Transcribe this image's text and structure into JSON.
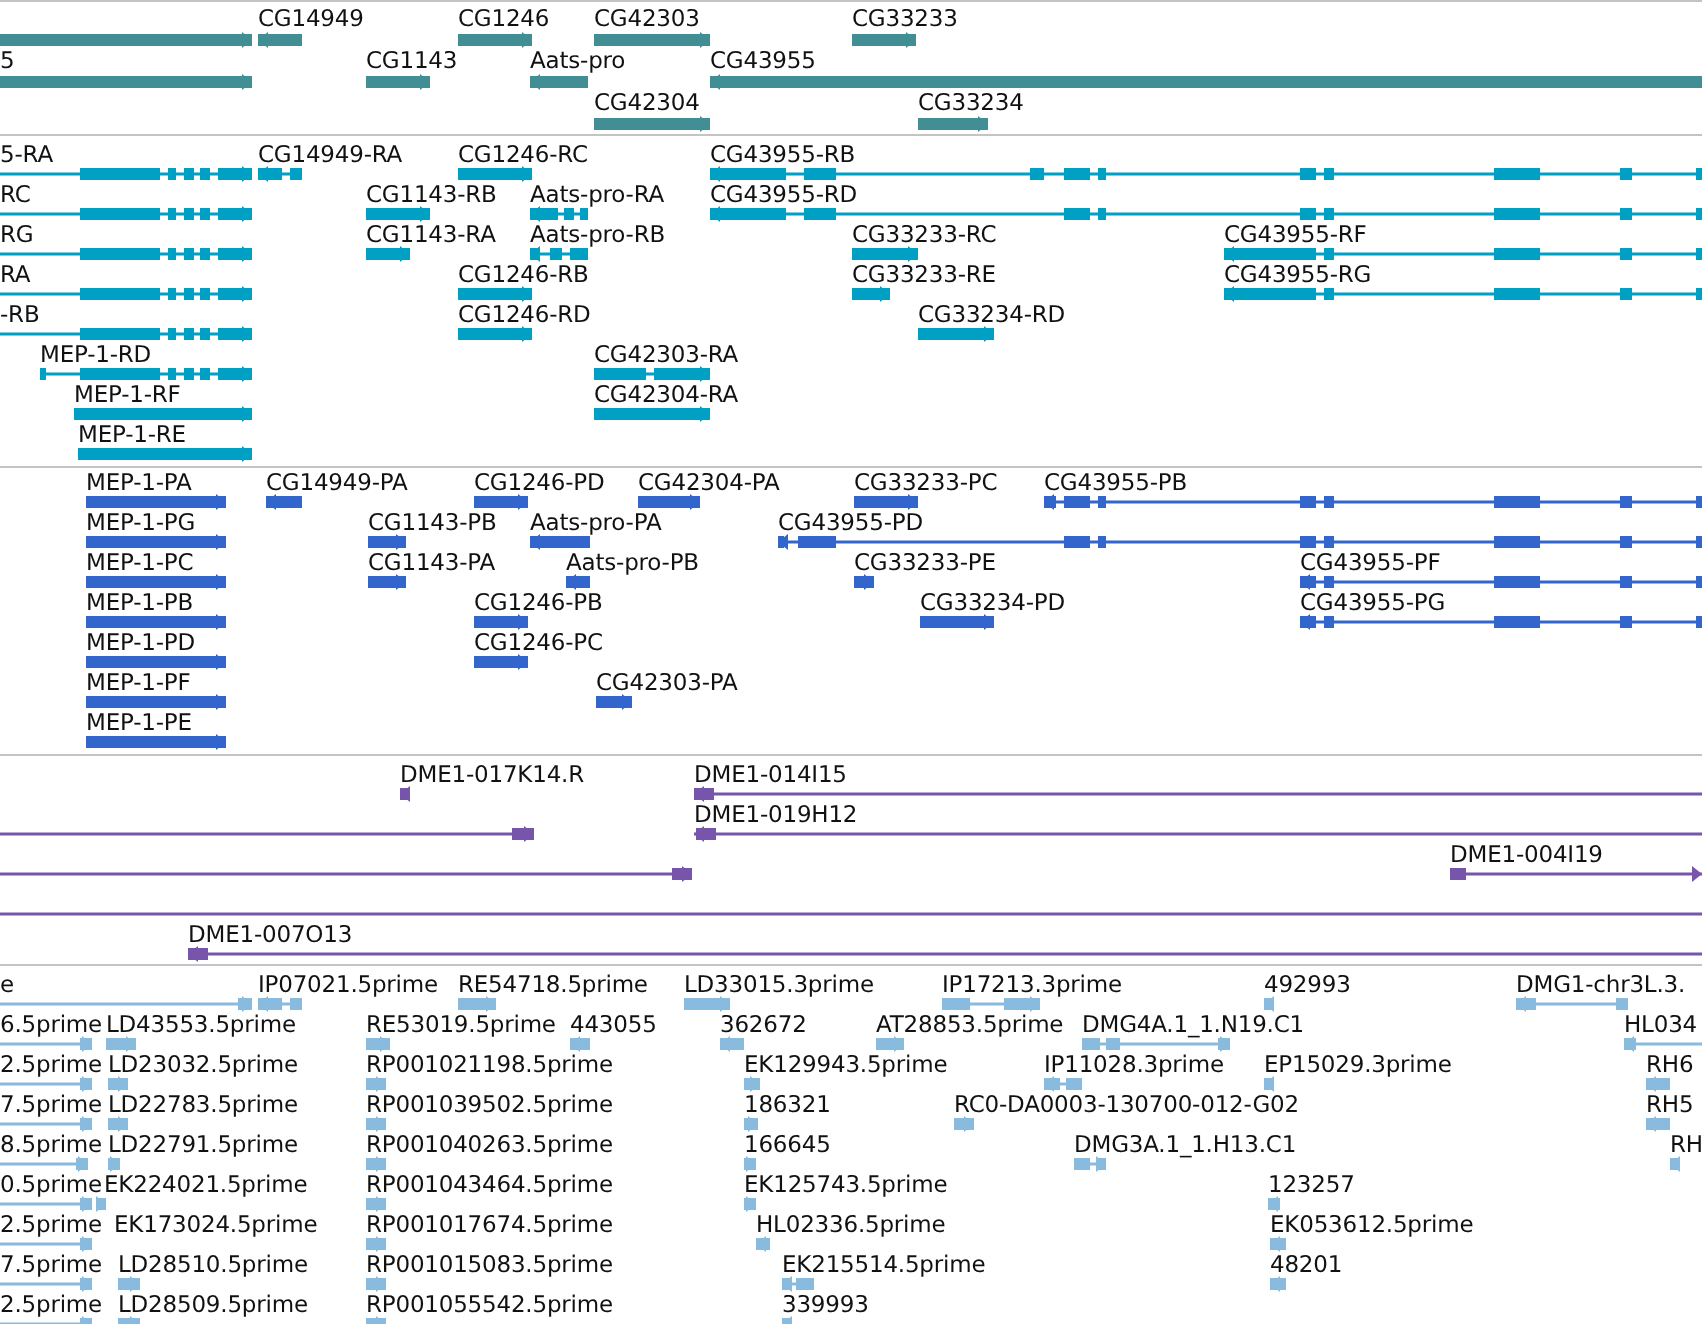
{
  "tracks": [
    {
      "kind": "gene",
      "features": [
        {
          "reverse": false
        },
        {
          "label": "CG14949",
          "reverse": true
        },
        {
          "label": "CG1246",
          "reverse": false
        },
        {
          "label": "CG42303",
          "reverse": false
        },
        {
          "label": "CG33233",
          "reverse": false
        },
        {
          "label": "5",
          "reverse": false
        },
        {
          "label": "CG1143",
          "reverse": false
        },
        {
          "label": "Aats-pro",
          "reverse": true
        },
        {
          "label": "CG43955",
          "reverse": true
        },
        {
          "label": "CG42304",
          "reverse": false
        },
        {
          "label": "CG33234",
          "reverse": false
        }
      ]
    },
    {
      "kind": "transcript",
      "features": [
        {
          "label": "5-RA",
          "reverse": false
        },
        {
          "label": "CG14949-RA",
          "reverse": true
        },
        {
          "label": "CG1246-RC",
          "reverse": false
        },
        {
          "label": "CG43955-RB",
          "reverse": true
        },
        {
          "label": "RC",
          "reverse": false
        },
        {
          "label": "CG1143-RB",
          "reverse": false
        },
        {
          "label": "Aats-pro-RA",
          "reverse": true
        },
        {
          "label": "CG43955-RD",
          "reverse": true
        },
        {
          "label": "RG",
          "reverse": false
        },
        {
          "label": "CG1143-RA",
          "reverse": false
        },
        {
          "label": "Aats-pro-RB",
          "reverse": true
        },
        {
          "label": "CG33233-RC",
          "reverse": false
        },
        {
          "label": "CG43955-RF",
          "reverse": true
        },
        {
          "label": "RA",
          "reverse": false
        },
        {
          "label": "CG1246-RB",
          "reverse": false
        },
        {
          "label": "CG33233-RE",
          "reverse": false
        },
        {
          "label": "CG43955-RG",
          "reverse": true
        },
        {
          "label": "-RB",
          "reverse": false
        },
        {
          "label": "CG1246-RD",
          "reverse": false
        },
        {
          "label": "CG33234-RD",
          "reverse": false
        },
        {
          "label": "MEP-1-RD",
          "reverse": false
        },
        {
          "label": "CG42303-RA",
          "reverse": false
        },
        {
          "label": "MEP-1-RF",
          "reverse": false
        },
        {
          "label": "CG42304-RA",
          "reverse": false
        },
        {
          "label": "MEP-1-RE",
          "reverse": false
        }
      ]
    },
    {
      "kind": "protein",
      "features": [
        {
          "label": "MEP-1-PA",
          "reverse": false
        },
        {
          "label": "CG14949-PA",
          "reverse": true
        },
        {
          "label": "CG1246-PD",
          "reverse": false
        },
        {
          "label": "CG42304-PA",
          "reverse": false
        },
        {
          "label": "CG33233-PC",
          "reverse": false
        },
        {
          "label": "CG43955-PB",
          "reverse": true
        },
        {
          "label": "MEP-1-PG",
          "reverse": false
        },
        {
          "label": "CG1143-PB",
          "reverse": false
        },
        {
          "label": "Aats-pro-PA",
          "reverse": true
        },
        {
          "label": "CG43955-PD",
          "reverse": true
        },
        {
          "label": "MEP-1-PC",
          "reverse": false
        },
        {
          "label": "CG1143-PA",
          "reverse": false
        },
        {
          "label": "Aats-pro-PB",
          "reverse": true
        },
        {
          "label": "CG33233-PE",
          "reverse": false
        },
        {
          "label": "CG43955-PF",
          "reverse": true
        },
        {
          "label": "MEP-1-PB",
          "reverse": false
        },
        {
          "label": "CG1246-PB",
          "reverse": false
        },
        {
          "label": "CG33234-PD",
          "reverse": false
        },
        {
          "label": "CG43955-PG",
          "reverse": true
        },
        {
          "label": "MEP-1-PD",
          "reverse": false
        },
        {
          "label": "CG1246-PC",
          "reverse": false
        },
        {
          "label": "MEP-1-PF",
          "reverse": false
        },
        {
          "label": "CG42303-PA",
          "reverse": false
        },
        {
          "label": "MEP-1-PE",
          "reverse": false
        }
      ]
    },
    {
      "kind": "clone",
      "features": [
        {
          "label": "DME1-017K14.R",
          "reverse": true
        },
        {
          "label": "DME1-014I15",
          "reverse": true
        },
        {
          "label": "DME1-019H12",
          "reverse": true
        },
        {
          "reverse": false
        },
        {
          "reverse": false
        },
        {
          "label": "DME1-004I19",
          "reverse": false
        },
        {
          "reverse": false
        },
        {
          "label": "DME1-007O13",
          "reverse": true
        }
      ]
    },
    {
      "kind": "est",
      "features": [
        {
          "label": "e",
          "reverse": false
        },
        {
          "label": "IP07021.5prime",
          "reverse": true
        },
        {
          "label": "RE54718.5prime",
          "reverse": false
        },
        {
          "label": "LD33015.3prime",
          "reverse": false
        },
        {
          "label": "IP17213.3prime",
          "reverse": false
        },
        {
          "label": "492993",
          "reverse": true
        },
        {
          "label": "DMG1-chr3L.3.",
          "reverse": true
        },
        {
          "label": "6.5prime",
          "reverse": false
        },
        {
          "label": "LD43553.5prime",
          "reverse": false
        },
        {
          "label": "RE53019.5prime",
          "reverse": false
        },
        {
          "label": "443055",
          "reverse": true
        },
        {
          "label": "362672",
          "reverse": true
        },
        {
          "label": "AT28853.5prime",
          "reverse": false
        },
        {
          "label": "DMG4A.1_1.N19.C1",
          "reverse": false
        },
        {
          "label": "HL034",
          "reverse": true
        },
        {
          "label": "2.5prime",
          "reverse": false
        },
        {
          "label": "LD23032.5prime",
          "reverse": false
        },
        {
          "label": "RP001021198.5prime",
          "reverse": false
        },
        {
          "label": "EK129943.5prime",
          "reverse": false
        },
        {
          "label": "IP11028.3prime",
          "reverse": true
        },
        {
          "label": "EP15029.3prime",
          "reverse": true
        },
        {
          "label": "RH6",
          "reverse": true
        },
        {
          "label": "7.5prime",
          "reverse": false
        },
        {
          "label": "LD22783.5prime",
          "reverse": false
        },
        {
          "label": "RP001039502.5prime",
          "reverse": false
        },
        {
          "label": "186321",
          "reverse": false
        },
        {
          "label": "RC0-DA0003-130700-012-G02",
          "reverse": false
        },
        {
          "label": "RH5",
          "reverse": true
        },
        {
          "label": "8.5prime",
          "reverse": false
        },
        {
          "label": "LD22791.5prime",
          "reverse": false
        },
        {
          "label": "RP001040263.5prime",
          "reverse": false
        },
        {
          "label": "166645",
          "reverse": false
        },
        {
          "label": "DMG3A.1_1.H13.C1",
          "reverse": false
        },
        {
          "label": "RH",
          "reverse": true
        },
        {
          "label": "0.5prime",
          "reverse": false
        },
        {
          "label": "EK224021.5prime",
          "reverse": false
        },
        {
          "label": "RP001043464.5prime",
          "reverse": false
        },
        {
          "label": "EK125743.5prime",
          "reverse": false
        },
        {
          "label": "123257",
          "reverse": true
        },
        {
          "label": "2.5prime",
          "reverse": false
        },
        {
          "label": "EK173024.5prime"
        },
        {
          "label": "RP001017674.5prime",
          "reverse": false
        },
        {
          "label": "HL02336.5prime",
          "reverse": true
        },
        {
          "label": "EK053612.5prime",
          "reverse": true
        },
        {
          "label": "7.5prime",
          "reverse": false
        },
        {
          "label": "LD28510.5prime",
          "reverse": false
        },
        {
          "label": "RP001015083.5prime",
          "reverse": false
        },
        {
          "label": "EK215514.5prime",
          "reverse": true
        },
        {
          "label": "48201",
          "reverse": true
        },
        {
          "label": "2.5prime",
          "reverse": false
        },
        {
          "label": "LD28509.5prime",
          "reverse": false
        },
        {
          "label": "RP001055542.5prime",
          "reverse": false
        },
        {
          "label": "339993",
          "reverse": true
        }
      ]
    }
  ]
}
